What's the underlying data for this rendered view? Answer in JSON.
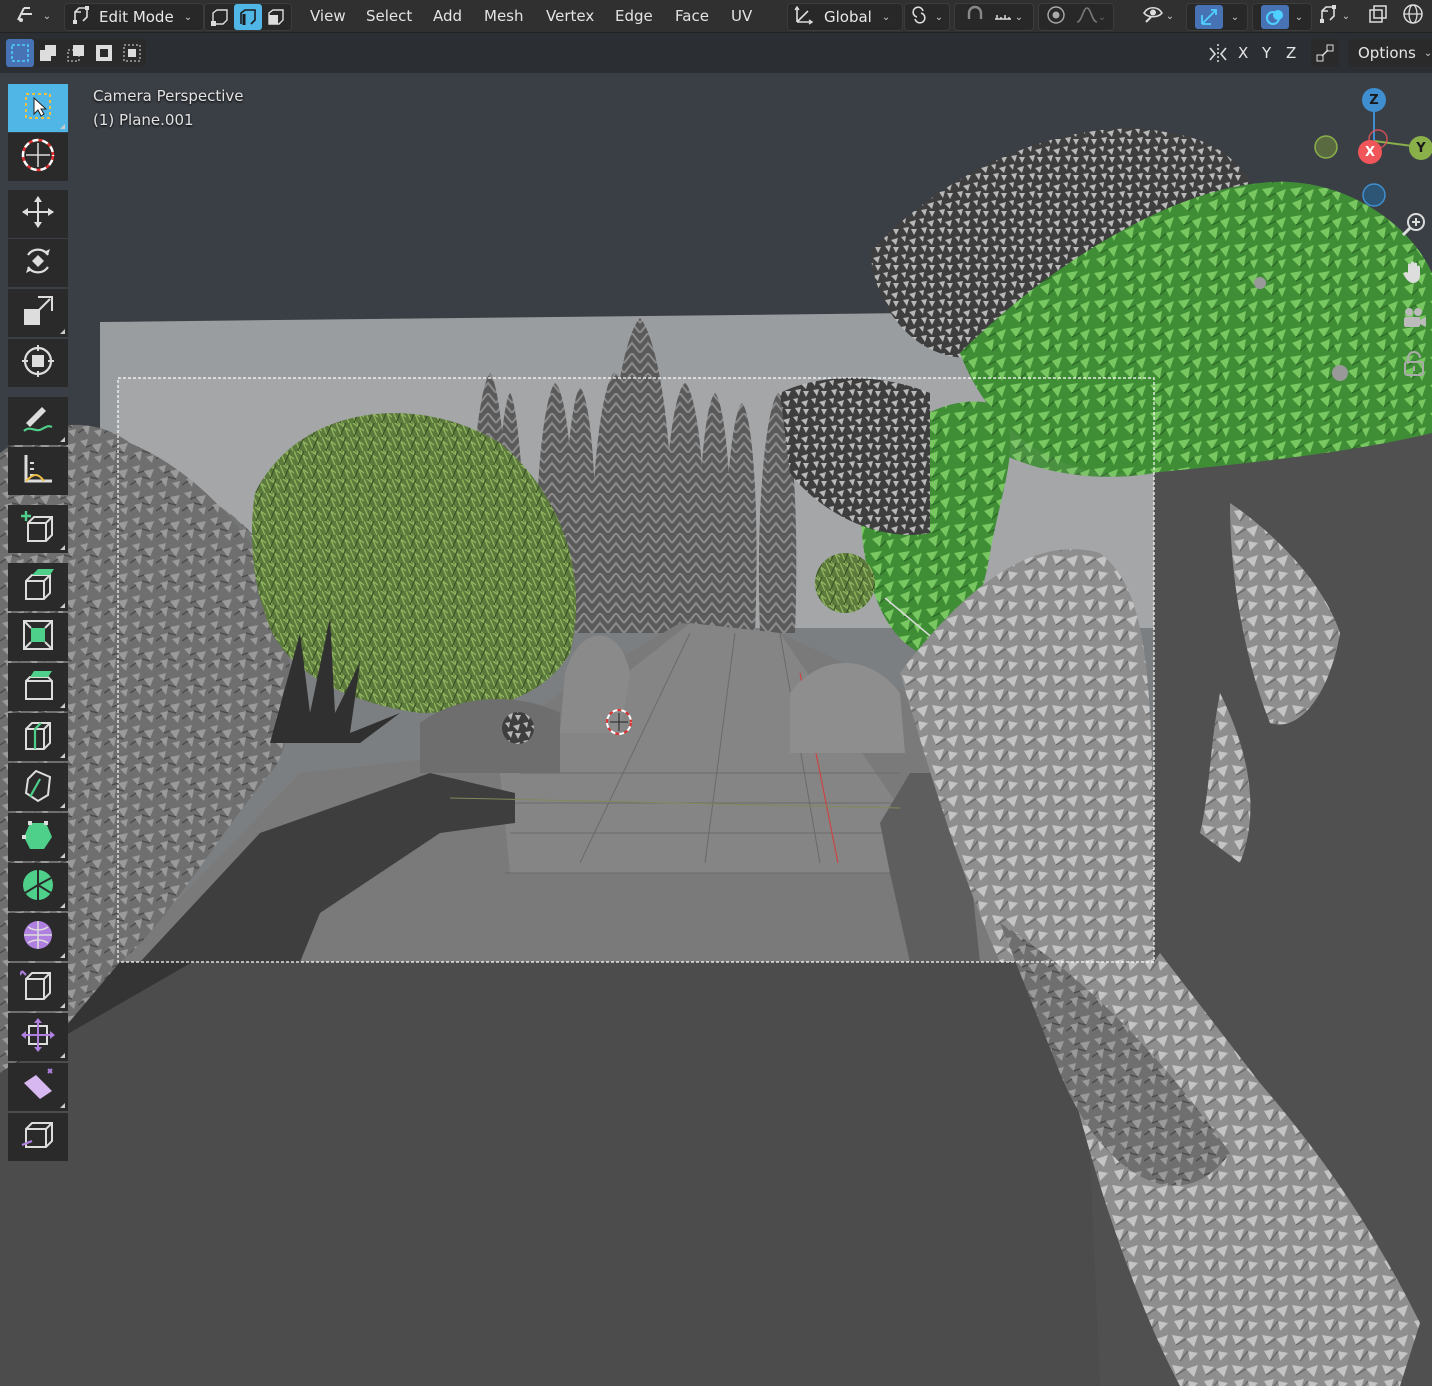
{
  "header": {
    "mode_label": "Edit Mode",
    "menus": [
      "View",
      "Select",
      "Add",
      "Mesh",
      "Vertex",
      "Edge",
      "Face",
      "UV"
    ],
    "transform_orientation": "Global",
    "icons": [
      "editor-type-icon",
      "edit-mode-icon",
      "vertex-select-icon",
      "edge-select-icon",
      "face-select-icon",
      "transform-orientation-icon",
      "pivot-point-icon",
      "snap-icon",
      "snap-increment-icon",
      "proportional-edit-icon",
      "falloff-icon",
      "visibility-icon",
      "gizmo-icon",
      "overlay-icon",
      "xray-icon",
      "mesh-edit-overlay-icon",
      "wireframe-shading-icon"
    ]
  },
  "subheader": {
    "axes": [
      "X",
      "Y",
      "Z"
    ],
    "options_label": "Options",
    "icons": [
      "select-box-new-icon",
      "select-box-extend-icon",
      "select-box-subtract-icon",
      "select-box-invert-icon",
      "select-box-intersect-icon",
      "mirror-icon",
      "auto-merge-icon"
    ]
  },
  "viewport": {
    "view_name": "Camera Perspective",
    "object_name": "(1) Plane.001"
  },
  "gizmo": {
    "axes": [
      "X",
      "Y",
      "Z"
    ],
    "colors": {
      "x": "#f0555a",
      "y": "#8ab04a",
      "z": "#3f8fd0"
    }
  },
  "navigation": {
    "icons": [
      "zoom-icon",
      "pan-hand-icon",
      "camera-view-icon",
      "lock-icon"
    ]
  },
  "toolbar": {
    "tools": [
      "select-box",
      "cursor",
      "move",
      "rotate",
      "scale",
      "transform",
      "annotate",
      "measure",
      "add-cube",
      "extrude-region",
      "inset-faces",
      "bevel",
      "loop-cut",
      "knife",
      "poly-build",
      "spin",
      "smooth",
      "edge-slide",
      "shrink-fatten",
      "shear",
      "rip-region"
    ]
  },
  "colors": {
    "header_bg": "#303030",
    "toolbar_selected": "#4fb6e6",
    "active_button": "#4772b3",
    "foliage_green": "#6fbf5a"
  }
}
